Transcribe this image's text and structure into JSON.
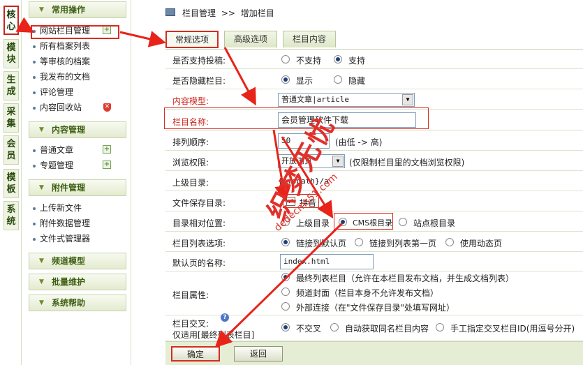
{
  "vtabs": [
    "核心",
    "模块",
    "生成",
    "采集",
    "会员",
    "模板",
    "系统"
  ],
  "sidebar": {
    "groups": [
      {
        "title": "常用操作"
      },
      {
        "title": "内容管理"
      },
      {
        "title": "附件管理"
      },
      {
        "title": "频道模型"
      },
      {
        "title": "批量维护"
      },
      {
        "title": "系统帮助"
      }
    ],
    "common_items": [
      "网站栏目管理",
      "所有档案列表",
      "等审核的档案",
      "我发布的文档",
      "评论管理",
      "内容回收站"
    ],
    "content_items": [
      "普通文章",
      "专题管理"
    ],
    "attach_items": [
      "上传新文件",
      "附件数据管理",
      "文件式管理器"
    ],
    "plus_symbol": "+",
    "shield_symbol": "✕"
  },
  "breadcrumb": {
    "section": "栏目管理",
    "sep": ">>",
    "page": "增加栏目"
  },
  "tabs": [
    "常规选项",
    "高级选项",
    "栏目内容"
  ],
  "form": {
    "post_label": "是否支持投稿:",
    "post_opts": [
      "不支持",
      "支持"
    ],
    "hide_label": "是否隐藏栏目:",
    "hide_opts": [
      "显示",
      "隐藏"
    ],
    "model_label": "内容模型:",
    "model_value": "普通文章|article",
    "name_label": "栏目名称:",
    "name_value": "会员管理软件下载",
    "order_label": "排列顺序:",
    "order_value": "50",
    "order_hint": "(由低 -> 高)",
    "perm_label": "浏览权限:",
    "perm_value": "开放浏览",
    "perm_hint": "(仅限制栏目里的文档浏览权限)",
    "parent_label": "上级目录:",
    "parent_value": "{cmspath}/a",
    "savedir_label": "文件保存目录:",
    "pinyin_label": "拼音",
    "rel_label": "目录相对位置:",
    "rel_opts": [
      "上级目录",
      "CMS根目录",
      "站点根目录"
    ],
    "list_label": "栏目列表选项:",
    "list_opts": [
      "链接到默认页",
      "链接到列表第一页",
      "使用动态页"
    ],
    "default_label": "默认页的名称:",
    "default_value": "index.html",
    "attr_label": "栏目属性:",
    "attr_opts": [
      "最终列表栏目（允许在本栏目发布文档，并生成文档列表）",
      "频道封面（栏目本身不允许发布文档）",
      "外部连接（在\"文件保存目录\"处填写网址）"
    ],
    "cross_label1": "栏目交叉:",
    "cross_label2": "仅适用[最终列表栏目]",
    "cross_opts": [
      "不交叉",
      "自动获取同名栏目内容",
      "手工指定交叉栏目ID(用逗号分开)"
    ]
  },
  "buttons": {
    "ok": "确定",
    "back": "返回"
  },
  "watermark": {
    "main": "织梦无忧",
    "sub": "dedecms51.com"
  },
  "colors": {
    "annotation_red": "#d42d20",
    "menu_green": "#3e5f12",
    "footer_bg": "#e6edd5"
  }
}
